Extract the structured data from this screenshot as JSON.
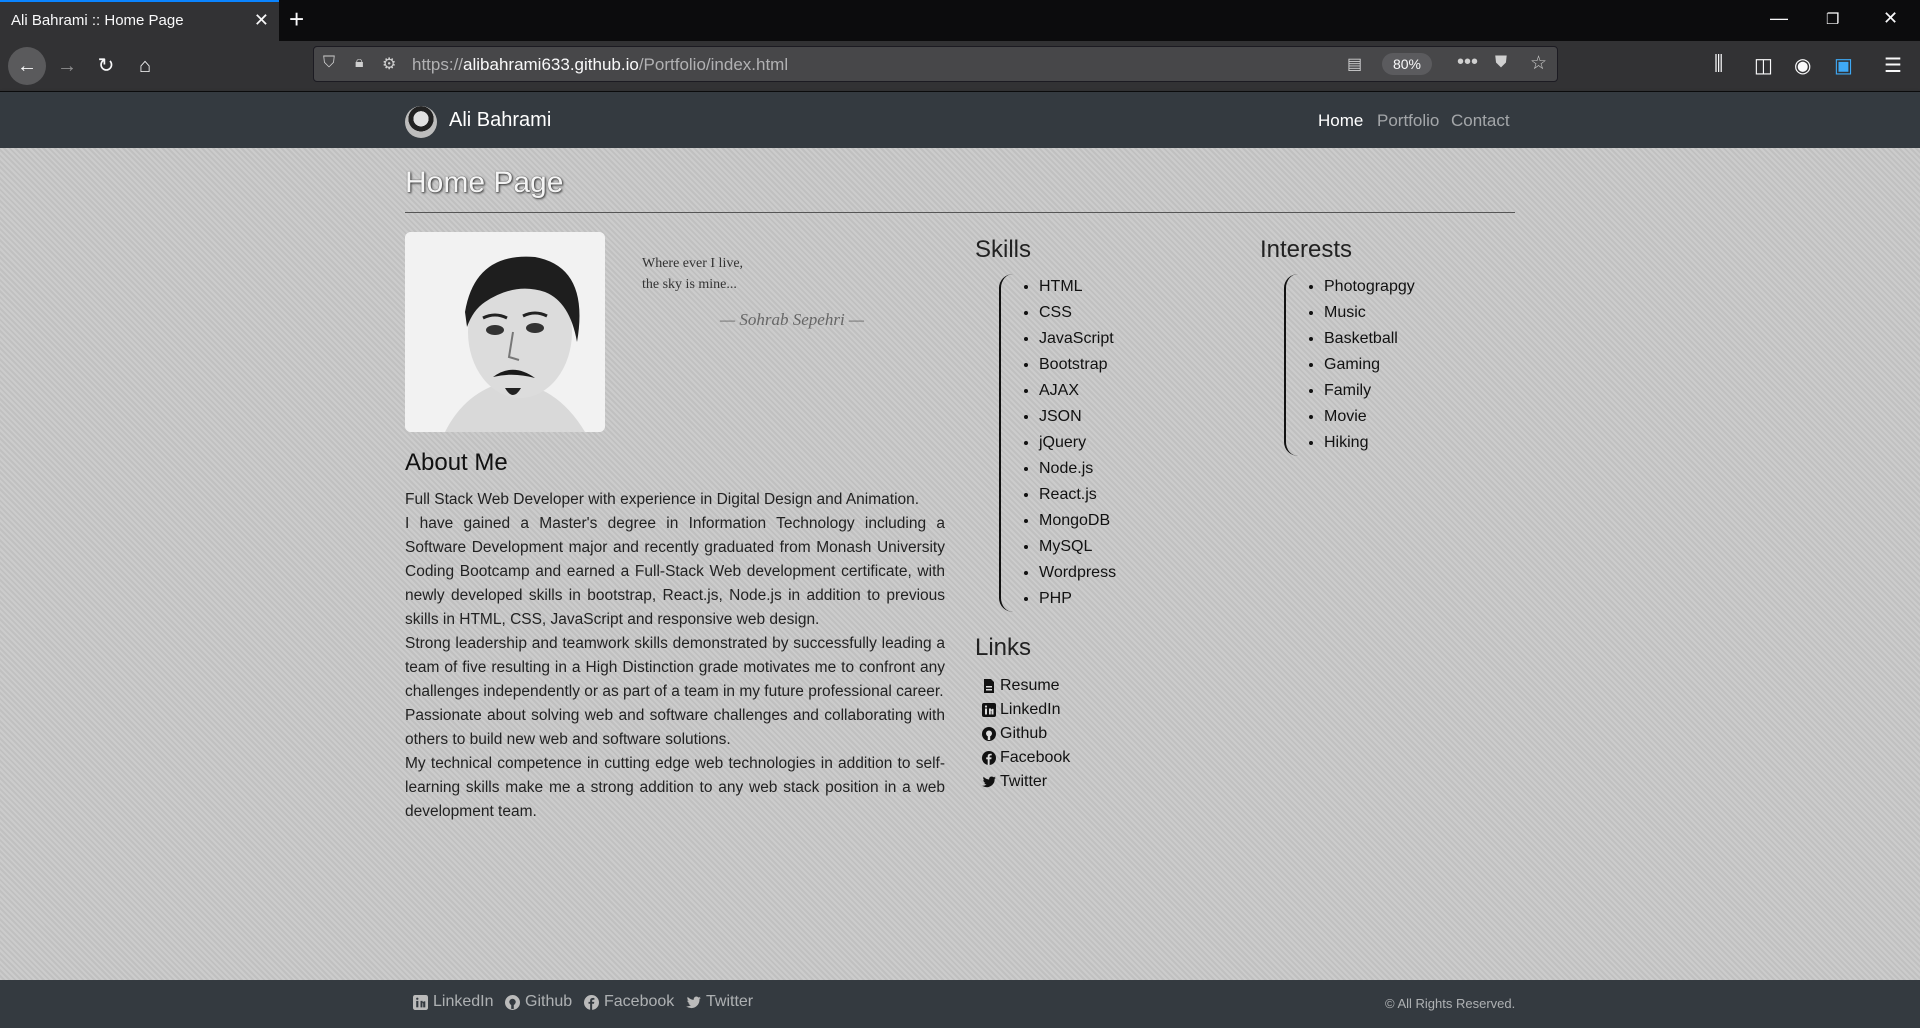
{
  "browser": {
    "tab_title": "Ali Bahrami :: Home Page",
    "url_scheme": "https://",
    "url_host": "alibahrami633.github.io",
    "url_path": "/Portfolio/index.html",
    "zoom": "80%"
  },
  "site": {
    "brand": "Ali Bahrami",
    "nav": {
      "home": "Home",
      "portfolio": "Portfolio",
      "contact": "Contact"
    },
    "page_title": "Home Page",
    "quote": {
      "line1": "Where ever I live,",
      "line2": "the sky is mine...",
      "author": "— Sohrab Sepehri —"
    },
    "about": {
      "heading": "About Me",
      "paragraphs": [
        "Full Stack Web Developer with experience in Digital Design and Animation.",
        "I have gained a Master's degree in Information Technology including a Software Development major and recently graduated from Monash University Coding Bootcamp and earned a Full-Stack Web development certificate, with newly developed skills in bootstrap, React.js, Node.js in addition to previous skills in HTML, CSS, JavaScript and responsive web design.",
        "Strong leadership and teamwork skills demonstrated by successfully leading a team of five resulting in a High Distinction grade motivates me to confront any challenges independently or as part of a team in my future professional career.",
        "Passionate about solving web and software challenges and collaborating with others to build new web and software solutions.",
        "My technical competence in cutting edge web technologies in addition to self-learning skills make me a strong addition to any web stack position in a web development team."
      ]
    },
    "skills": {
      "heading": "Skills",
      "items": [
        "HTML",
        "CSS",
        "JavaScript",
        "Bootstrap",
        "AJAX",
        "JSON",
        "jQuery",
        "Node.js",
        "React.js",
        "MongoDB",
        "MySQL",
        "Wordpress",
        "PHP"
      ]
    },
    "interests": {
      "heading": "Interests",
      "items": [
        "Photograpgy",
        "Music",
        "Basketball",
        "Gaming",
        "Family",
        "Movie",
        "Hiking"
      ]
    },
    "links": {
      "heading": "Links",
      "items": [
        "Resume",
        "LinkedIn",
        "Github",
        "Facebook",
        "Twitter"
      ]
    },
    "footer": {
      "links": [
        "LinkedIn",
        "Github",
        "Facebook",
        "Twitter"
      ],
      "copyright": "© All Rights Reserved."
    }
  }
}
